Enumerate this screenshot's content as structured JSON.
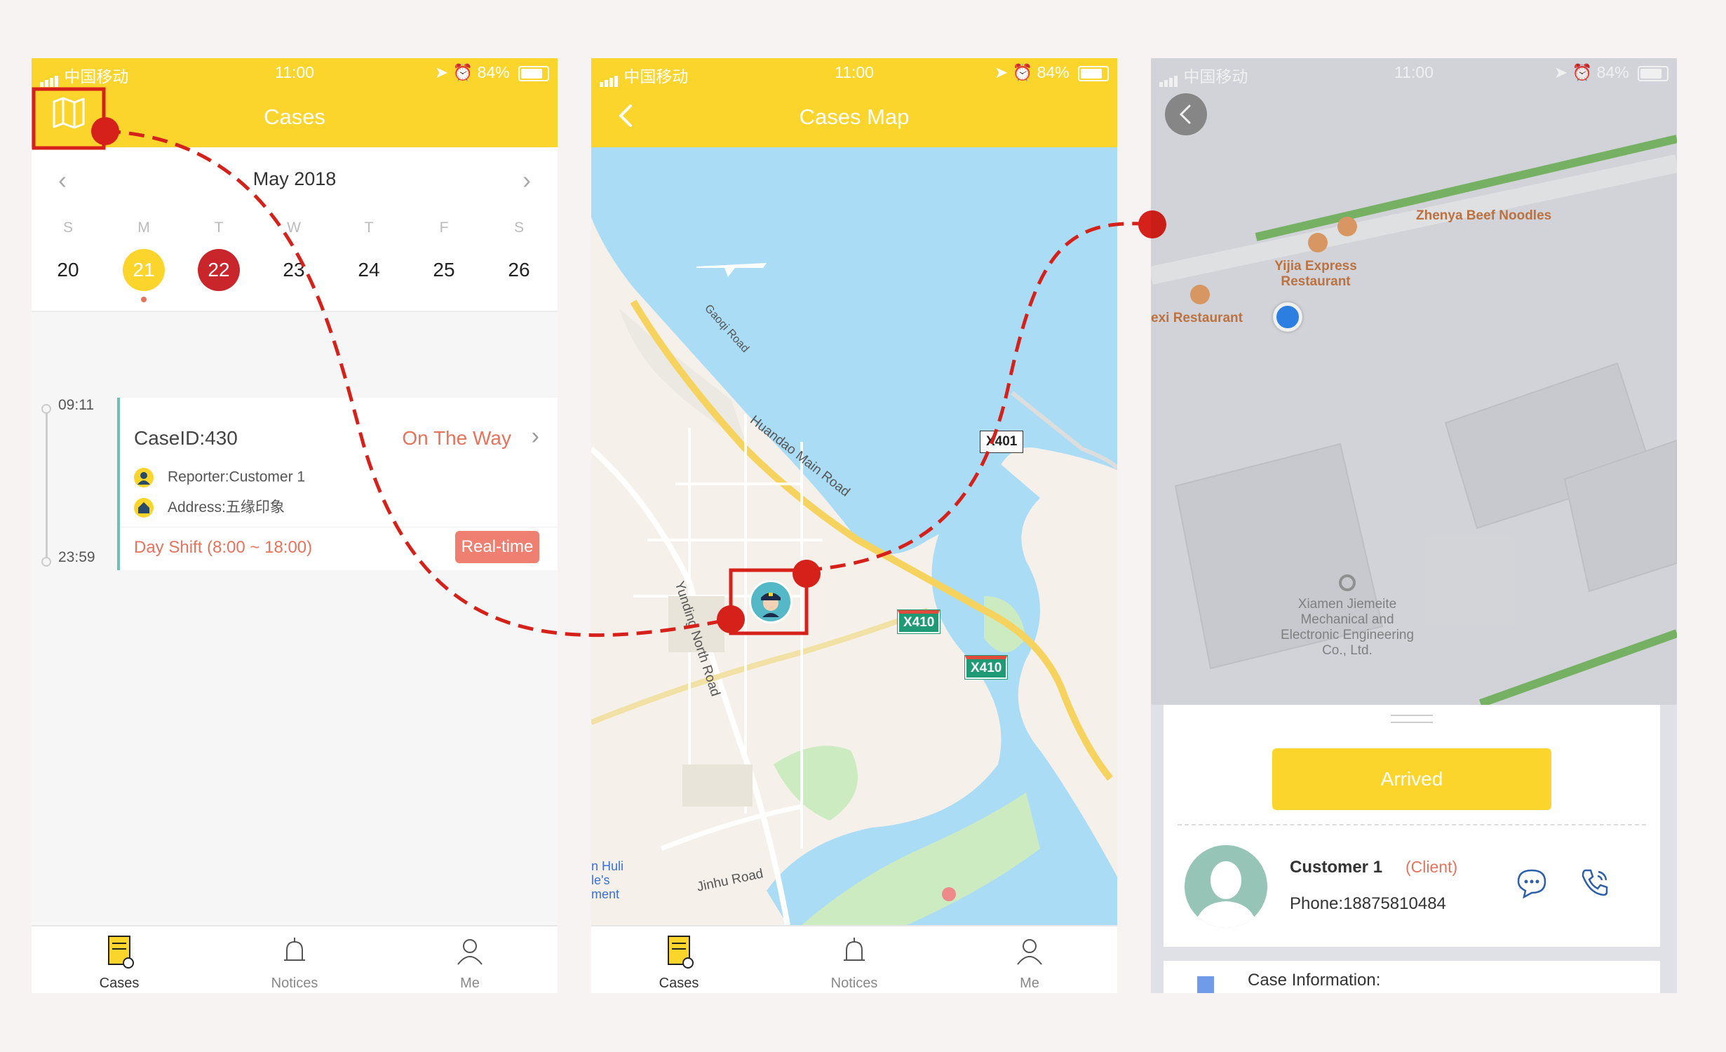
{
  "status": {
    "carrier": "中国移动",
    "time": "11:00",
    "battery": "84%"
  },
  "screen1": {
    "title": "Cases",
    "calendar": {
      "month": "May 2018",
      "weekdays": [
        "S",
        "M",
        "T",
        "W",
        "T",
        "F",
        "S"
      ],
      "days": [
        "20",
        "21",
        "22",
        "23",
        "24",
        "25",
        "26"
      ]
    },
    "timeline": {
      "start": "09:11",
      "end": "23:59"
    },
    "case": {
      "id": "CaseID:430",
      "status": "On The Way",
      "reporter": "Reporter:Customer 1",
      "address": "Address:五缘印象",
      "shift": "Day Shift (8:00 ~ 18:00)",
      "button": "Real-time"
    }
  },
  "screen2": {
    "title": "Cases Map",
    "roads": {
      "huandao": "Huandao Main Road",
      "yunding": "Yunding North Road",
      "gaoqi": "Gaoqi Road",
      "jinhu": "Jinhu Road",
      "huli": "n Huli",
      "les": "le's",
      "ment": "ment"
    },
    "shields": {
      "x401": "X401",
      "x410a": "X410",
      "x410b": "X410"
    }
  },
  "screen3": {
    "pois": {
      "zhenya": "Zhenya Beef Noodles",
      "yijia": "Yijia Express Restaurant",
      "exi": "exi Restaurant",
      "xiamen": "Xiamen Jiemeite Mechanical and Electronic Engineering Co., Ltd."
    },
    "arrived": "Arrived",
    "customer": {
      "name": "Customer 1",
      "role": "(Client)",
      "phone": "Phone:18875810484"
    },
    "case_info": "Case Information:"
  },
  "tabs": {
    "cases": "Cases",
    "notices": "Notices",
    "me": "Me"
  },
  "colors": {
    "primary": "#fcd52c",
    "accent": "#e6735c",
    "highlight_red": "#d6201a",
    "selected_day": "#c9262c",
    "water": "#abdcf5"
  }
}
